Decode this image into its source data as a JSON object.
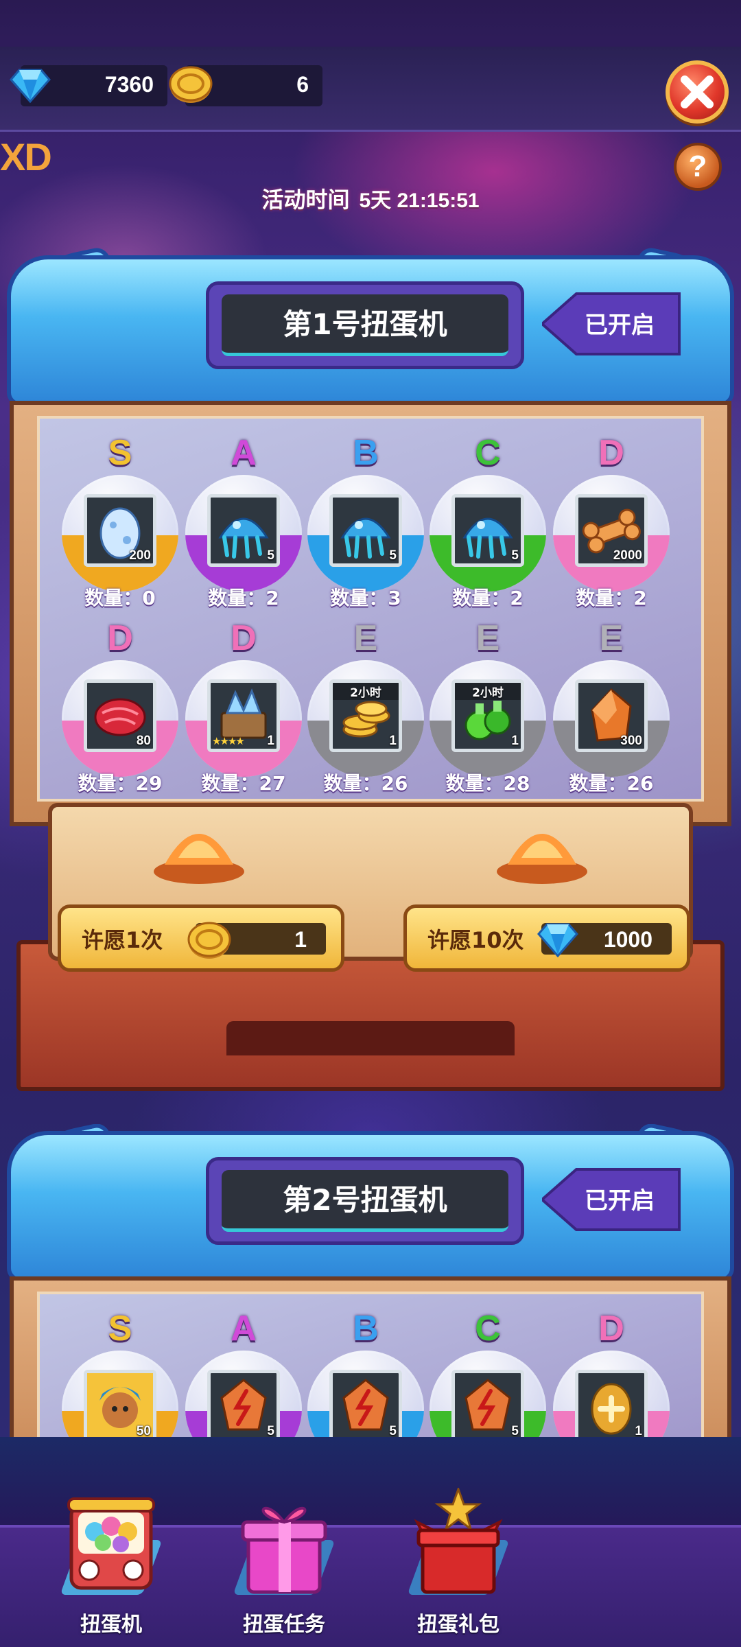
{
  "currency": {
    "gems": "7360",
    "coins": "6"
  },
  "header": {
    "activity_label": "活动时间",
    "activity_timer": "5天 21:15:51",
    "help": "?",
    "logo_text": "XD"
  },
  "machines": [
    {
      "title": "第1号扭蛋机",
      "status": "已开启",
      "capsules_row1": [
        {
          "grade": "S",
          "item": "egg-icon",
          "badge": "200",
          "qty": "数量：0",
          "color": "#f0a820"
        },
        {
          "grade": "A",
          "item": "jelly-icon",
          "badge": "5",
          "qty": "数量：2",
          "color": "#a63cd6"
        },
        {
          "grade": "B",
          "item": "jelly-icon",
          "badge": "5",
          "qty": "数量：3",
          "color": "#2aa0e8"
        },
        {
          "grade": "C",
          "item": "jelly-icon",
          "badge": "5",
          "qty": "数量：2",
          "color": "#3dbb2a"
        },
        {
          "grade": "D",
          "item": "bone-icon",
          "badge": "2000",
          "qty": "数量：2",
          "color": "#f07ac0"
        }
      ],
      "capsules_row2": [
        {
          "grade": "D",
          "item": "meat-icon",
          "badge": "80",
          "qty": "数量：29",
          "color": "#f07ac0"
        },
        {
          "grade": "D",
          "item": "crystal-chest-icon",
          "badge": "1",
          "stars": "★★★★",
          "qty": "数量：27",
          "color": "#f07ac0"
        },
        {
          "grade": "E",
          "item": "coin-stack-icon",
          "badge": "1",
          "hours": "2小时",
          "qty": "数量：26",
          "color": "#8a8a90"
        },
        {
          "grade": "E",
          "item": "potion-icon",
          "badge": "1",
          "hours": "2小时",
          "qty": "数量：28",
          "color": "#8a8a90"
        },
        {
          "grade": "E",
          "item": "amber-stone-icon",
          "badge": "300",
          "qty": "数量：26",
          "color": "#8a8a90"
        }
      ],
      "wish_once": {
        "label": "许愿1次",
        "cost": "1",
        "currency": "coin"
      },
      "wish_ten": {
        "label": "许愿10次",
        "cost": "1000",
        "currency": "gem"
      }
    },
    {
      "title": "第2号扭蛋机",
      "status": "已开启",
      "capsules_row1": [
        {
          "grade": "S",
          "item": "hero-portrait-icon",
          "badge": "50",
          "color": "#f0a820"
        },
        {
          "grade": "A",
          "item": "rune-stone-icon",
          "badge": "5",
          "color": "#a63cd6"
        },
        {
          "grade": "B",
          "item": "rune-stone-icon",
          "badge": "5",
          "color": "#2aa0e8"
        },
        {
          "grade": "C",
          "item": "rune-stone-icon",
          "badge": "5",
          "color": "#3dbb2a"
        },
        {
          "grade": "D",
          "item": "gold-egg-icon",
          "badge": "1",
          "color": "#f07ac0"
        }
      ]
    }
  ],
  "grade_colors": {
    "S": "#f2c230",
    "A": "#d04ad8",
    "B": "#3aa0f0",
    "C": "#3dc23a",
    "D": "#f070b8",
    "E": "#b0b0b8"
  },
  "nav": [
    {
      "label": "扭蛋机",
      "icon": "capsule-machine-icon"
    },
    {
      "label": "扭蛋任务",
      "icon": "gift-box-icon"
    },
    {
      "label": "扭蛋礼包",
      "icon": "red-gift-box-icon"
    }
  ]
}
